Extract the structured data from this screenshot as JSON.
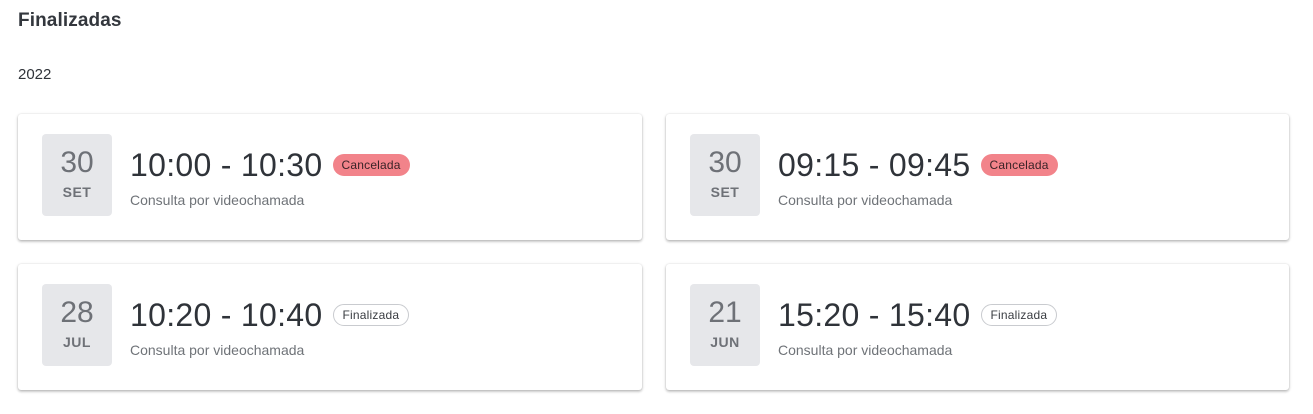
{
  "section": {
    "title": "Finalizadas",
    "year": "2022"
  },
  "appointments": [
    {
      "day": "30",
      "month": "SET",
      "time": "10:00 - 10:30",
      "status": "Cancelada",
      "status_type": "cancelled",
      "description": "Consulta por videochamada"
    },
    {
      "day": "30",
      "month": "SET",
      "time": "09:15 - 09:45",
      "status": "Cancelada",
      "status_type": "cancelled",
      "description": "Consulta por videochamada"
    },
    {
      "day": "28",
      "month": "JUL",
      "time": "10:20 - 10:40",
      "status": "Finalizada",
      "status_type": "finished",
      "description": "Consulta por videochamada"
    },
    {
      "day": "21",
      "month": "JUN",
      "time": "15:20 - 15:40",
      "status": "Finalizada",
      "status_type": "finished",
      "description": "Consulta por videochamada"
    }
  ],
  "colors": {
    "cancelled_badge": "#f2838a",
    "finished_badge_border": "#c9cbcf",
    "date_box_bg": "#e6e7ea"
  }
}
